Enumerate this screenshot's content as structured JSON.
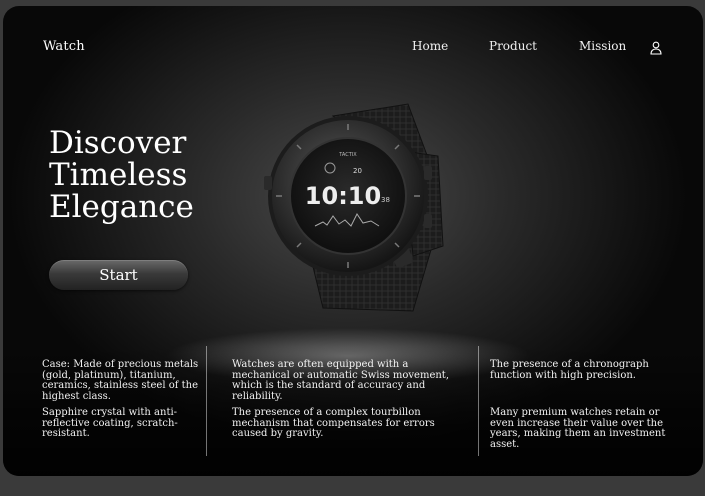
{
  "header": {
    "logo": "Watch",
    "nav": [
      {
        "label": "Home"
      },
      {
        "label": "Product"
      },
      {
        "label": "Mission"
      }
    ],
    "user_icon": "user-icon"
  },
  "hero": {
    "title_lines": [
      "Discover",
      "Timeless",
      "Elegance"
    ],
    "start_label": "Start"
  },
  "watch_face": {
    "brand": "TACTIX",
    "top_value": "20",
    "time": "10:10",
    "seconds": "38"
  },
  "features": [
    "Case: Made of precious metals (gold, platinum), titanium, ceramics, stainless steel of the highest class.",
    "Sapphire crystal with anti-reflective coating, scratch-resistant.",
    "Watches are often equipped with a mechanical or automatic Swiss movement, which is the standard of accuracy and reliability.",
    "The presence of a complex tourbillon mechanism that compensates for errors caused by gravity.",
    "The presence of a chronograph function with high precision.",
    "Many premium watches retain or even increase their value over the years, making them an investment asset."
  ]
}
